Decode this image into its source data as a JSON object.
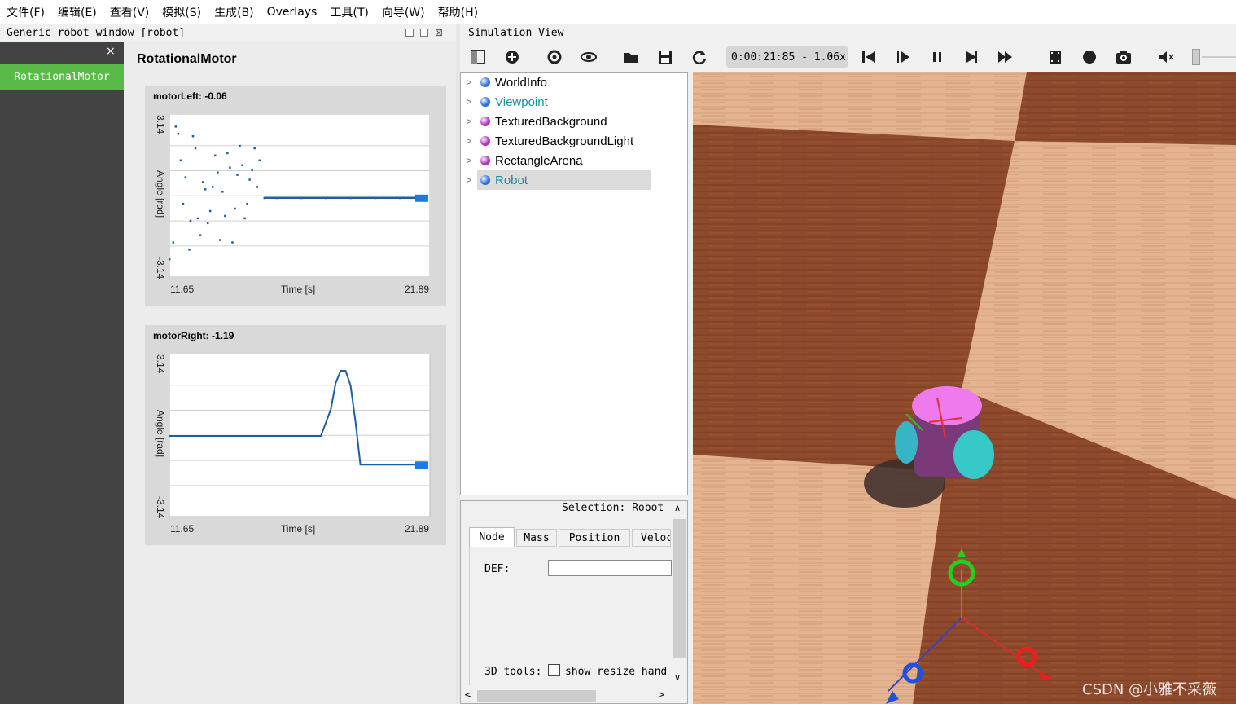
{
  "menu": [
    "文件(F)",
    "编辑(E)",
    "查看(V)",
    "模拟(S)",
    "生成(B)",
    "Overlays",
    "工具(T)",
    "向导(W)",
    "帮助(H)"
  ],
  "robot_window": {
    "title": "Generic robot window [robot]",
    "tab_label": "RotationalMotor",
    "close_glyph": "×",
    "panel_title": "RotationalMotor"
  },
  "charts_text": {
    "left": {
      "title": "motorLeft: -0.06",
      "ymax": "3.14",
      "ymin": "-3.14",
      "ylabel": "Angle [rad]",
      "xmin": "11.65",
      "xmax": "21.89",
      "xlabel": "Time [s]"
    },
    "right": {
      "title": "motorRight: -1.19",
      "ymax": "3.14",
      "ymin": "-3.14",
      "ylabel": "Angle [rad]",
      "xmin": "11.65",
      "xmax": "21.89",
      "xlabel": "Time [s]"
    }
  },
  "chart_data": [
    {
      "type": "scatter",
      "title": "motorLeft: -0.06",
      "xlabel": "Time [s]",
      "ylabel": "Angle [rad]",
      "xlim": [
        11.65,
        21.89
      ],
      "ylim": [
        -3.14,
        3.14
      ],
      "series": [
        {
          "x": [
            11.65,
            11.8,
            11.9,
            12.0,
            12.1,
            12.2,
            12.3,
            12.45,
            12.5,
            12.6,
            12.7,
            12.8,
            12.9,
            13.0,
            13.1,
            13.2,
            13.3,
            13.4,
            13.5,
            13.6,
            13.7,
            13.8,
            13.9,
            14.0,
            14.1,
            14.2,
            14.3,
            14.4,
            14.5,
            14.6,
            14.7,
            14.8,
            14.9,
            15.0,
            15.1,
            15.2,
            15.3,
            15.5,
            16.0,
            17.0,
            18.0,
            19.0,
            20.0,
            21.0,
            21.89
          ],
          "y": [
            -2.6,
            -1.9,
            2.9,
            2.6,
            1.5,
            -0.3,
            0.8,
            -2.2,
            -1.0,
            2.5,
            2.0,
            -0.9,
            -1.6,
            0.6,
            0.3,
            -1.1,
            -0.6,
            0.4,
            1.7,
            1.0,
            -1.8,
            0.2,
            -0.8,
            1.8,
            1.2,
            -1.9,
            -0.5,
            0.9,
            2.1,
            1.3,
            -0.9,
            -0.3,
            0.7,
            1.1,
            2.0,
            0.4,
            1.5,
            -0.06,
            -0.06,
            -0.06,
            -0.06,
            -0.06,
            -0.06,
            -0.06,
            -0.06
          ]
        }
      ]
    },
    {
      "type": "line",
      "title": "motorRight: -1.19",
      "xlabel": "Time [s]",
      "ylabel": "Angle [rad]",
      "xlim": [
        11.65,
        21.89
      ],
      "ylim": [
        -3.14,
        3.14
      ],
      "series": [
        {
          "x": [
            11.65,
            14.0,
            16.0,
            17.8,
            18.2,
            18.4,
            18.6,
            18.8,
            19.0,
            19.2,
            19.4,
            20.0,
            21.0,
            21.89
          ],
          "y": [
            0.0,
            0.0,
            0.0,
            0.0,
            1.1,
            2.2,
            2.7,
            2.7,
            2.1,
            0.6,
            -1.19,
            -1.19,
            -1.19,
            -1.19
          ]
        }
      ]
    }
  ],
  "sim": {
    "title": "Simulation View",
    "time": "0:00:21:85 -  1.06x",
    "tree": [
      {
        "label": "WorldInfo",
        "color": "#2a6fdb"
      },
      {
        "label": "Viewpoint",
        "color": "#2a6fdb"
      },
      {
        "label": "TexturedBackground",
        "color": "#b030c0"
      },
      {
        "label": "TexturedBackgroundLight",
        "color": "#b030c0"
      },
      {
        "label": "RectangleArena",
        "color": "#b030c0"
      },
      {
        "label": "Robot",
        "color": "#2a6fdb"
      }
    ],
    "selection": "Selection: Robot",
    "tabs": [
      "Node",
      "Mass",
      "Position",
      "Veloc"
    ],
    "def_label": "DEF:",
    "def_value": "",
    "tools_label": "3D tools:",
    "resize_label": "show resize hand"
  },
  "watermark": "CSDN @小雅不采薇"
}
